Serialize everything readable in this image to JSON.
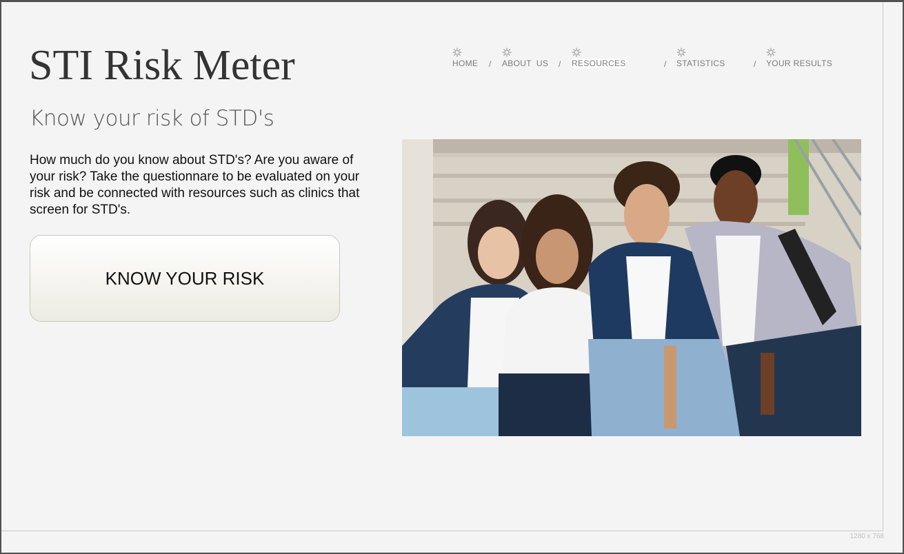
{
  "site": {
    "title": "STI Risk Meter",
    "subtitle": "Know your risk of STD's",
    "intro": "How much do you know about STD's? Are you aware of your risk? Take the questionnare to be evaluated on your risk and be connected with resources such as clinics that screen for STD's.",
    "cta_label": "KNOW YOUR RISK"
  },
  "nav": {
    "icon": "gear-icon",
    "separator": "/",
    "items": [
      {
        "label": "HOME"
      },
      {
        "label": "ABOUT  US"
      },
      {
        "label": "RESOURCES",
        "active": true
      },
      {
        "label": "STATISTICS"
      },
      {
        "label": "YOUR RESULTS"
      }
    ]
  },
  "canvas_size_label": "1280 x 768",
  "colors": {
    "background": "#f4f4f4",
    "title": "#333333",
    "nav_text": "#7b7b7b",
    "button_border": "#c7c7bf"
  }
}
